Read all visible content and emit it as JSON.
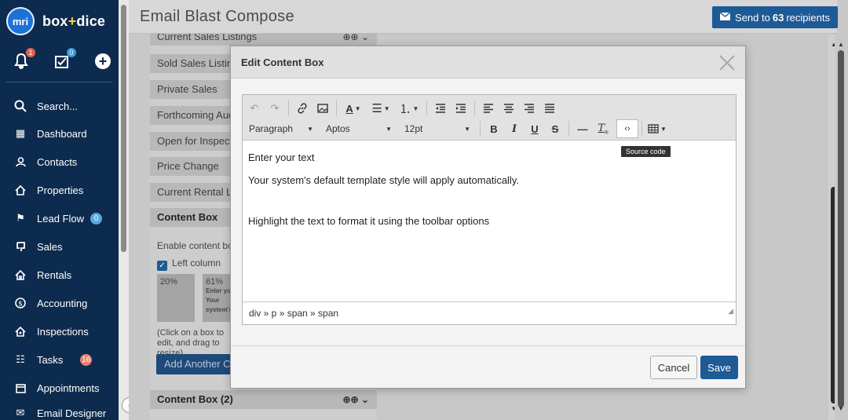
{
  "brand": {
    "logo_text": "mri",
    "name_a": "box",
    "name_plus": "+",
    "name_b": "dice"
  },
  "quick": {
    "notifications_count": "1",
    "tasks_count": "0"
  },
  "nav": {
    "search": "Search...",
    "items": [
      {
        "label": "Dashboard",
        "icon": "dashboard-icon"
      },
      {
        "label": "Contacts",
        "icon": "contacts-icon"
      },
      {
        "label": "Properties",
        "icon": "properties-icon"
      },
      {
        "label": "Lead Flow",
        "icon": "lead-flow-icon",
        "count": "0"
      },
      {
        "label": "Sales",
        "icon": "sales-icon"
      },
      {
        "label": "Rentals",
        "icon": "rentals-icon"
      },
      {
        "label": "Accounting",
        "icon": "accounting-icon"
      },
      {
        "label": "Inspections",
        "icon": "inspections-icon"
      },
      {
        "label": "Tasks",
        "icon": "tasks-icon",
        "count": "16"
      },
      {
        "label": "Appointments",
        "icon": "appointments-icon"
      },
      {
        "label": "Email Designer",
        "icon": "email-designer-icon"
      }
    ]
  },
  "header": {
    "title": "Email Blast Compose",
    "send_prefix": "Send to",
    "send_count": "63",
    "send_suffix": "recipients"
  },
  "panel": {
    "rows": [
      "Current Sales Listings",
      "Sold Sales Listings",
      "Private Sales",
      "Forthcoming Auctions",
      "Open for Inspections",
      "Price Change",
      "Current Rental Listings",
      "Content Box"
    ],
    "enable_text": "Enable content boxes",
    "left_column": "Left column",
    "left_pct": "20%",
    "right_pct": "61%",
    "right_line1": "Enter your text",
    "right_line2": "Your system's default template style will apply",
    "hint": "(Click on a box to edit, and drag to resize)",
    "add_button": "Add Another Content Box",
    "bottom_row": "Content Box (2)"
  },
  "modal": {
    "title": "Edit Content Box",
    "toolbar": {
      "format": "Paragraph",
      "font": "Aptos",
      "size": "12pt",
      "tooltip": "Source code"
    },
    "content": {
      "line1": "Enter your text",
      "line2": "Your system's default template style will apply automatically.",
      "line3": "Highlight the text to format it using the toolbar options"
    },
    "path": "div » p » span » span",
    "cancel": "Cancel",
    "save": "Save"
  }
}
